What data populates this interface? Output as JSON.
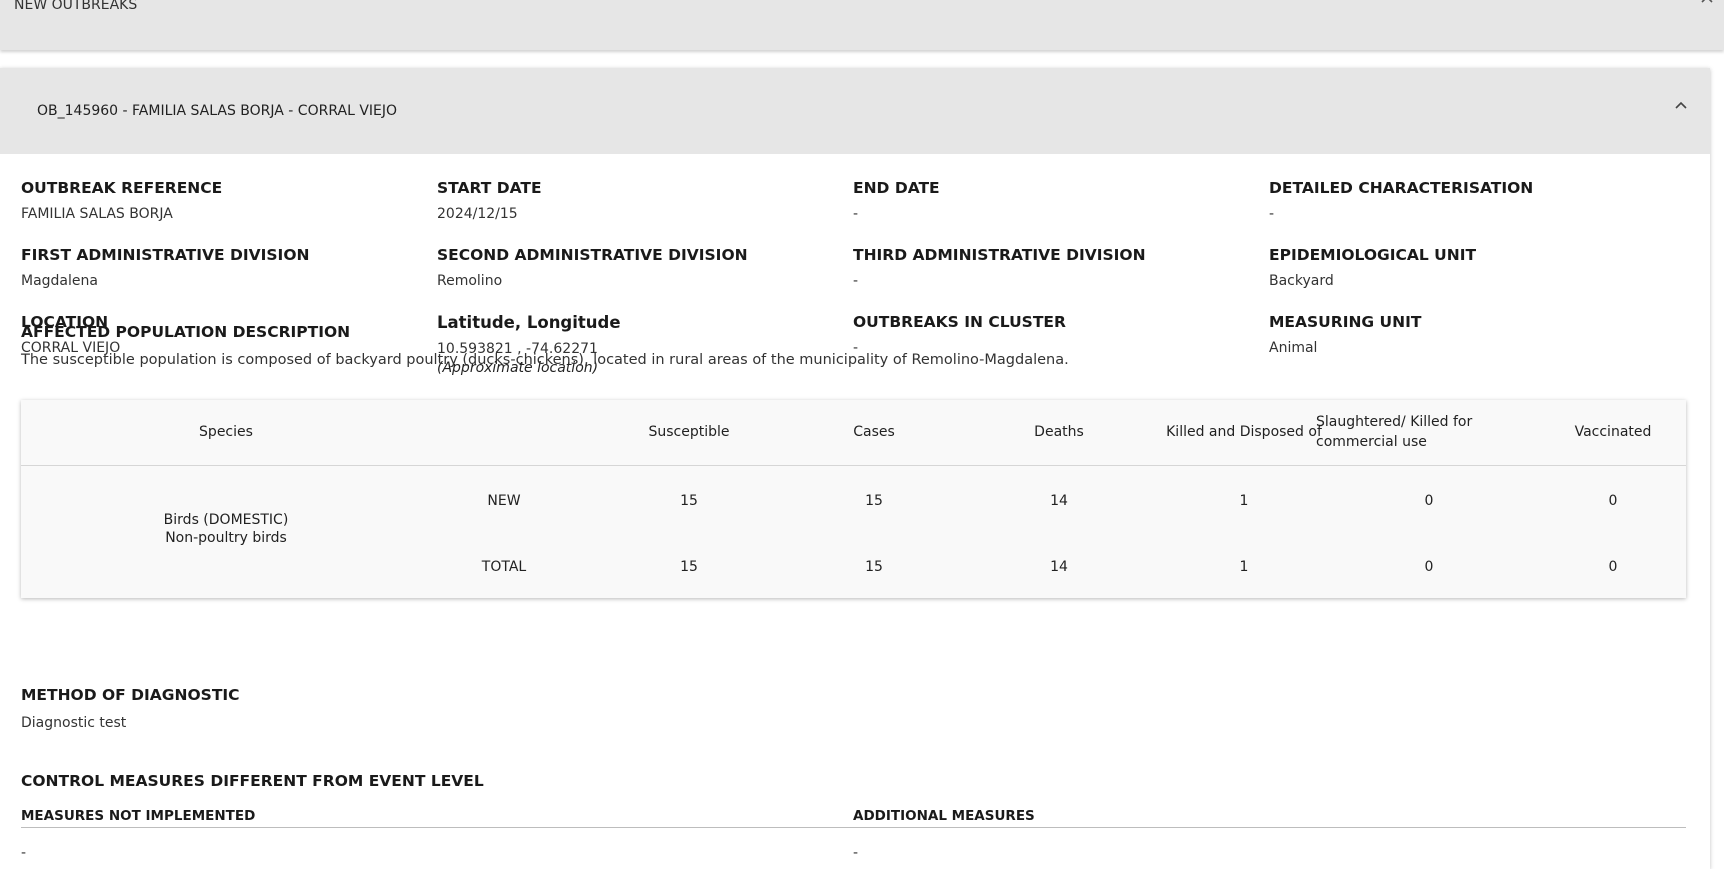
{
  "top_bar": {
    "title": "NEW OUTBREAKS",
    "chevron_icon": "chevron-up-icon"
  },
  "outbreak": {
    "header_title": "OB_145960 - FAMILIA SALAS BORJA - CORRAL VIEJO",
    "chevron_icon": "chevron-up-icon",
    "fields": {
      "outbreak_reference": {
        "label": "OUTBREAK REFERENCE",
        "value": "FAMILIA SALAS BORJA"
      },
      "start_date": {
        "label": "START DATE",
        "value": "2024/12/15"
      },
      "end_date": {
        "label": "END DATE",
        "value": "-"
      },
      "detailed_characterisation": {
        "label": "DETAILED CHARACTERISATION",
        "value": "-"
      },
      "first_admin_division": {
        "label": "FIRST ADMINISTRATIVE DIVISION",
        "value": "Magdalena"
      },
      "second_admin_division": {
        "label": "SECOND ADMINISTRATIVE DIVISION",
        "value": "Remolino"
      },
      "third_admin_division": {
        "label": "THIRD ADMINISTRATIVE DIVISION",
        "value": "-"
      },
      "epidemiological_unit": {
        "label": "EPIDEMIOLOGICAL UNIT",
        "value": "Backyard"
      },
      "location": {
        "label": "LOCATION",
        "value": "CORRAL VIEJO"
      },
      "lat_long": {
        "label": "Latitude, Longitude",
        "value": "10.593821 , -74.62271",
        "note": "(Approximate location)"
      },
      "outbreaks_in_cluster": {
        "label": "OUTBREAKS IN CLUSTER",
        "value": "-"
      },
      "measuring_unit": {
        "label": "MEASURING UNIT",
        "value": "Animal"
      }
    },
    "affected_population": {
      "label": "AFFECTED POPULATION DESCRIPTION",
      "value": "The susceptible population is composed of backyard poultry (ducks-chickens), located in rural areas of the municipality of Remolino-Magdalena."
    },
    "table": {
      "headers": {
        "species": "Species",
        "susceptible": "Susceptible",
        "cases": "Cases",
        "deaths": "Deaths",
        "killed_disposed": "Killed and Disposed of",
        "slaughtered_line1": "Slaughtered/ Killed for",
        "slaughtered_line2": "commercial use",
        "vaccinated": "Vaccinated"
      },
      "species_line1": "Birds (DOMESTIC)",
      "species_line2": "Non-poultry birds",
      "rows": [
        {
          "label": "NEW",
          "susceptible": "15",
          "cases": "15",
          "deaths": "14",
          "killed_disposed": "1",
          "slaughtered": "0",
          "vaccinated": "0"
        },
        {
          "label": "TOTAL",
          "susceptible": "15",
          "cases": "15",
          "deaths": "14",
          "killed_disposed": "1",
          "slaughtered": "0",
          "vaccinated": "0"
        }
      ]
    },
    "diagnostic": {
      "label": "METHOD OF DIAGNOSTIC",
      "value": "Diagnostic test"
    },
    "control_measures": {
      "title": "CONTROL MEASURES DIFFERENT FROM EVENT LEVEL",
      "not_implemented_label": "MEASURES NOT IMPLEMENTED",
      "not_implemented_value": "-",
      "additional_label": "ADDITIONAL MEASURES",
      "additional_value": "-"
    }
  }
}
